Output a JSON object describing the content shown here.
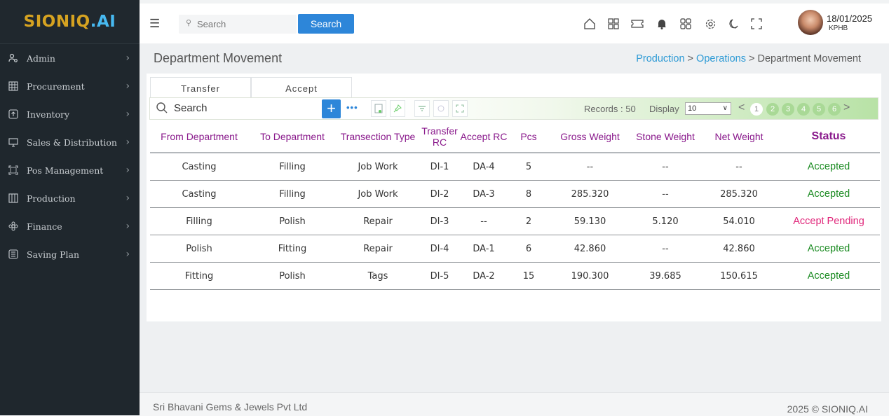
{
  "app": {
    "logo_text": "SIONIQ",
    "logo_suffix": ".AI"
  },
  "sidebar": {
    "items": [
      {
        "label": "Admin",
        "icon": "users-icon"
      },
      {
        "label": "Procurement",
        "icon": "grid-icon"
      },
      {
        "label": "Inventory",
        "icon": "box-arrow-up-icon"
      },
      {
        "label": "Sales & Distribution",
        "icon": "monitor-icon"
      },
      {
        "label": "Pos Management",
        "icon": "frame-icon"
      },
      {
        "label": "Production",
        "icon": "columns-icon"
      },
      {
        "label": "Finance",
        "icon": "flower-icon"
      },
      {
        "label": "Saving Plan",
        "icon": "list-box-icon"
      }
    ]
  },
  "header": {
    "search_placeholder": "Search",
    "search_button": "Search",
    "date": "18/01/2025",
    "location": "KPHB"
  },
  "page": {
    "title": "Department Movement",
    "breadcrumb": {
      "a": "Production",
      "b": "Operations",
      "current": "Department Movement",
      "sep": ">"
    }
  },
  "tabs": [
    "Transfer",
    "Accept"
  ],
  "toolbar": {
    "search_label": "Search",
    "plus": "+",
    "records_label": "Records : 50",
    "display_label": "Display",
    "display_value": "10",
    "pages": [
      "1",
      "2",
      "3",
      "4",
      "5",
      "6"
    ],
    "active_page": "1"
  },
  "table": {
    "columns": [
      "From Department",
      "To Department",
      "Transection Type",
      "Transfer RC",
      "Accept RC",
      "Pcs",
      "Gross Weight",
      "Stone Weight",
      "Net Weight",
      "Status"
    ],
    "rows": [
      [
        "Casting",
        "Filling",
        "Job Work",
        "DI-1",
        "DA-4",
        "5",
        "--",
        "--",
        "--",
        "Accepted"
      ],
      [
        "Casting",
        "Filling",
        "Job Work",
        "DI-2",
        "DA-3",
        "8",
        "285.320",
        "--",
        "285.320",
        "Accepted"
      ],
      [
        "Filling",
        "Polish",
        "Repair",
        "DI-3",
        "--",
        "2",
        "59.130",
        "5.120",
        "54.010",
        "Accept Pending"
      ],
      [
        "Polish",
        "Fitting",
        "Repair",
        "DI-4",
        "DA-1",
        "6",
        "42.860",
        "--",
        "42.860",
        "Accepted"
      ],
      [
        "Fitting",
        "Polish",
        "Tags",
        "DI-5",
        "DA-2",
        "15",
        "190.300",
        "39.685",
        "150.615",
        "Accepted"
      ]
    ]
  },
  "footer": {
    "company": "Sri Bhavani Gems & Jewels Pvt Ltd",
    "copyright": "2025 © SIONIQ.AI"
  },
  "colors": {
    "sidebar_bg": "#1f272d",
    "accent": "#2d86d9",
    "header_text": "#8a1a8c",
    "accepted": "#1b8b22",
    "pending": "#e0267a"
  }
}
